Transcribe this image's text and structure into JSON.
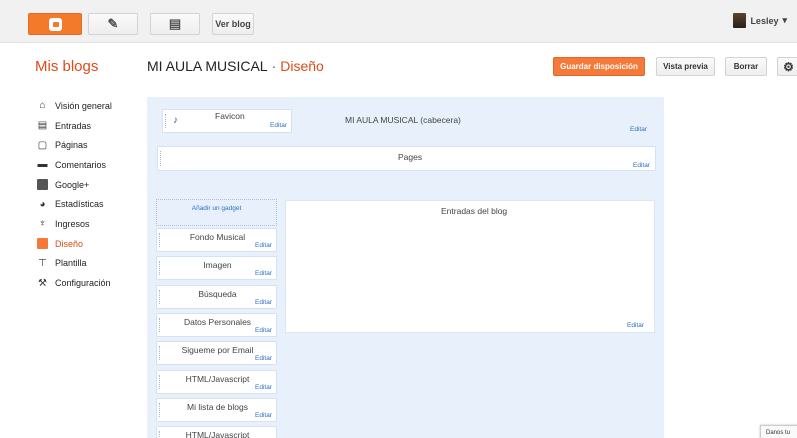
{
  "toolbar": {
    "view_blog": "Ver blog",
    "user": "Lesley",
    "user_caret": "▾"
  },
  "title_row": {
    "my_blogs": "Mis blogs",
    "blog_name": "MI AULA MUSICAL",
    "separator": "·",
    "section": "Diseño",
    "save_label": "Guardar disposición",
    "preview_label": "Vista previa",
    "delete_label": "Borrar"
  },
  "sidebar": {
    "items": [
      {
        "label": "Visión general",
        "icon": "home-icon"
      },
      {
        "label": "Entradas",
        "icon": "posts-icon"
      },
      {
        "label": "Páginas",
        "icon": "pages-icon"
      },
      {
        "label": "Comentarios",
        "icon": "comments-icon"
      },
      {
        "label": "Google+",
        "icon": "google-plus-icon"
      },
      {
        "label": "Estadísticas",
        "icon": "stats-icon"
      },
      {
        "label": "Ingresos",
        "icon": "earnings-icon"
      },
      {
        "label": "Diseño",
        "icon": "layout-icon",
        "active": true
      },
      {
        "label": "Plantilla",
        "icon": "template-icon"
      },
      {
        "label": "Configuración",
        "icon": "settings-icon"
      }
    ]
  },
  "layout": {
    "edit_label": "Editar",
    "favicon": "Favicon",
    "header": "MI AULA MUSICAL (cabecera)",
    "pages": "Pages",
    "add_gadget": "Añadir un gadget",
    "blog_posts": "Entradas del blog",
    "sidebar_gadgets": [
      "Fondo Musical",
      "Imagen",
      "Búsqueda",
      "Datos Personales",
      "Sigueme por Email",
      "HTML/Javascript",
      "Mi lista de blogs",
      "HTML/Javascript"
    ]
  },
  "feedback": "Danos tu"
}
